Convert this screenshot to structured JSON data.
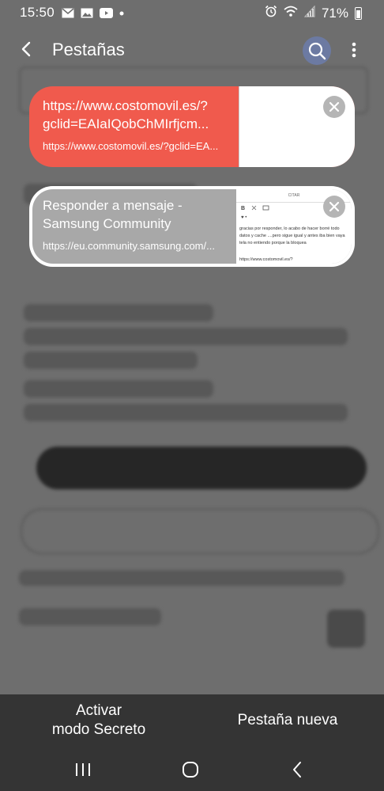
{
  "status_bar": {
    "time": "15:50",
    "left_icons": [
      "gmail-icon",
      "gallery-icon",
      "youtube-icon",
      "dot-icon"
    ],
    "right_icons": [
      "alarm-icon",
      "wifi-icon",
      "signal-icon"
    ],
    "battery": "71%"
  },
  "header": {
    "title": "Pestañas"
  },
  "tabs": [
    {
      "title": "https://www.costomovil.es/?gclid=EAIaIQobChMIrfjcm...",
      "url": "https://www.costomovil.es/?gclid=EA...",
      "color": "#f05a4d"
    },
    {
      "title": "Responder a mensaje - Samsung Community",
      "url": "https://eu.community.samsung.com/...",
      "color": "#a8a8a8",
      "thumbnail": {
        "toolbar": "CITAR",
        "text": "gracias por responder, lo acabo de hacer borré todo datos y cache ....pero sigue igual y antes iba bien vaya tela no entiendo porque la bloquea",
        "url": "https://www.costomovil.es/?"
      }
    }
  ],
  "bottom_actions": {
    "secret_mode": "Activar\nmodo Secreto",
    "new_tab": "Pestaña nueva"
  },
  "nav": [
    "recents-icon",
    "home-icon",
    "back-nav-icon"
  ]
}
